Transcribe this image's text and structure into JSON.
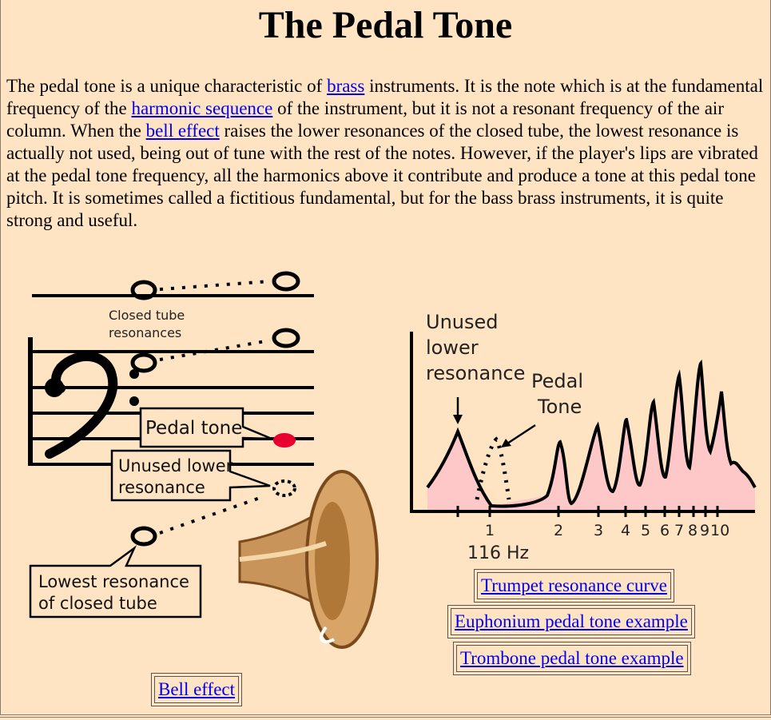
{
  "title": "The Pedal Tone",
  "intro": {
    "t1": "The pedal tone is a unique characteristic of ",
    "link_brass": "brass",
    "t2": " instruments. It is the note which is at the fundamental frequency of the ",
    "link_harmonic": "harmonic sequence",
    "t3": " of the instrument, but it is not a resonant frequency of the air column. When the ",
    "link_bell": "bell effect",
    "t4": " raises the lower resonances of the closed tube, the lowest resonance is actually not used, being out of tune with the rest of the notes. However, if the player's lips are vibrated at the pedal tone frequency, all the harmonics above it contribute and produce a tone at this pedal tone pitch. It is sometimes called a fictitious fundamental, but for the bass brass instruments, it is quite strong and useful."
  },
  "staff_figure": {
    "closed_tube_line1": "Closed tube",
    "closed_tube_line2": "resonances",
    "pedal_tone": "Pedal tone",
    "unused_line1": "Unused lower",
    "unused_line2": "resonance",
    "lowest_line1": "Lowest resonance",
    "lowest_line2": "of closed tube"
  },
  "curve_figure": {
    "unused_line1": "Unused",
    "unused_line2": "lower",
    "unused_line3": "resonance",
    "pedal_line1": "Pedal",
    "pedal_line2": "Tone",
    "ticks": [
      "1",
      "2",
      "3",
      "4",
      "5",
      "6",
      "7",
      "8",
      "9",
      "10"
    ],
    "freq_label": "116 Hz"
  },
  "links": {
    "trumpet": "Trumpet resonance curve",
    "euphonium": "Euphonium pedal tone example",
    "trombone": "Trombone pedal tone example",
    "bell": "Bell effect"
  },
  "colors": {
    "background": "#FFE4C4",
    "link": "#0000EE",
    "pedal_note": "#E8002E",
    "curve_fill": "#FFC8C8",
    "bell_brass": "#C8945A"
  }
}
